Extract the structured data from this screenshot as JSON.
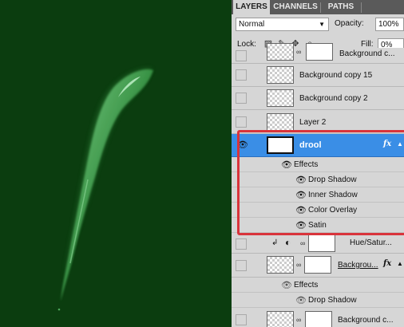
{
  "tabs": [
    {
      "label": "LAYERS",
      "active": true
    },
    {
      "label": "CHANNELS",
      "active": false
    },
    {
      "label": "PATHS",
      "active": false
    }
  ],
  "blend_mode": "Normal",
  "opacity": {
    "label": "Opacity:",
    "value": "100%"
  },
  "lock": {
    "label": "Lock:"
  },
  "fill": {
    "label": "Fill:",
    "value": "0%"
  },
  "layers": [
    {
      "name": "Background c...",
      "visible": false,
      "has_mask": true
    },
    {
      "name": "Background copy 15",
      "visible": false
    },
    {
      "name": "Background copy 2",
      "visible": false
    },
    {
      "name": "Layer 2",
      "visible": false
    },
    {
      "name": "drool",
      "visible": true,
      "selected": true,
      "fx": "fx"
    },
    {
      "name": "Hue/Satur...",
      "visible": false,
      "adjustment": true
    },
    {
      "name": "Backgrou...",
      "visible": false,
      "has_mask": true,
      "fx": "fx"
    },
    {
      "name": "Background c...",
      "visible": false,
      "has_mask": true
    }
  ],
  "drool_effects": {
    "header": "Effects",
    "items": [
      "Drop Shadow",
      "Inner Shadow",
      "Color Overlay",
      "Satin"
    ]
  },
  "bg_effects": {
    "header": "Effects",
    "items": [
      "Drop Shadow"
    ]
  },
  "colors": {
    "canvas_bg": "#0b3d0f",
    "drool_highlight": "#6fc97a",
    "selection": "#3a8ee6",
    "annotation": "#d9343b"
  }
}
